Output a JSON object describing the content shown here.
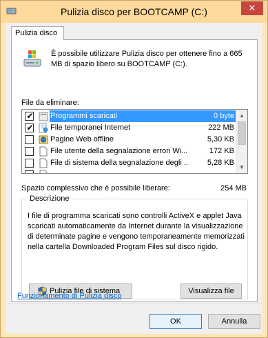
{
  "window": {
    "title": "Pulizia disco per BOOTCAMP (C:)",
    "close_glyph": "✕",
    "icons": {
      "app": "disk-cleanup-icon",
      "drive": "drive-icon"
    }
  },
  "tab": {
    "label": "Pulizia disco"
  },
  "intro": {
    "text": "È possibile utilizzare Pulizia disco per ottenere fino a 665 MB di spazio libero su BOOTCAMP (C:)."
  },
  "files": {
    "label": "File da eliminare:",
    "items": [
      {
        "checked": true,
        "selected": true,
        "name": "Programmi scaricati",
        "size": "0 byte",
        "icon": "folder-icon"
      },
      {
        "checked": true,
        "selected": false,
        "name": "File temporanei Internet",
        "size": "222 MB",
        "icon": "internet-files-icon"
      },
      {
        "checked": false,
        "selected": false,
        "name": "Pagine Web offline",
        "size": "5,30 KB",
        "icon": "offline-pages-icon"
      },
      {
        "checked": false,
        "selected": false,
        "name": "File utente della segnalazione errori Wi...",
        "size": "172 KB",
        "icon": "file-icon"
      },
      {
        "checked": false,
        "selected": false,
        "name": "File di sistema della segnalazione degli ...",
        "size": "5,28 KB",
        "icon": "file-icon"
      },
      {
        "checked": false,
        "selected": false,
        "name": "",
        "size": "",
        "icon": "file-icon"
      }
    ]
  },
  "total": {
    "label": "Spazio complessivo che è possibile liberare:",
    "value": "254 MB"
  },
  "description": {
    "title": "Descrizione",
    "text": "I file di programma scaricati sono controlli ActiveX e applet Java scaricati automaticamente da Internet durante la visualizzazione di determinate pagine e vengono temporaneamente memorizzati nella cartella Downloaded Program Files sul disco rigido.",
    "clean_system_label": "Pulizia file di sistema",
    "view_files_label": "Visualizza file"
  },
  "link": {
    "label": "Funzionamento di Pulizia disco"
  },
  "footer": {
    "ok_label": "OK",
    "cancel_label": "Annulla"
  },
  "colors": {
    "titlebar": "#fdd99b",
    "close": "#c7463f",
    "selection": "#3399ff",
    "link": "#0066cc"
  }
}
